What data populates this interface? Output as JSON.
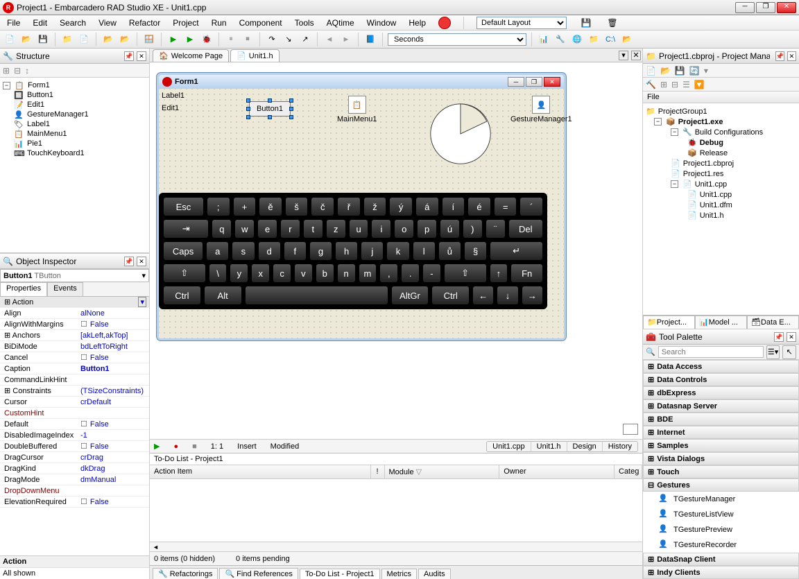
{
  "window": {
    "title": "Project1 - Embarcadero RAD Studio XE - Unit1.cpp"
  },
  "menu": {
    "items": [
      "File",
      "Edit",
      "Search",
      "View",
      "Refactor",
      "Project",
      "Run",
      "Component",
      "Tools",
      "AQtime",
      "Window",
      "Help"
    ],
    "layout_combo": "Default Layout"
  },
  "toolbar2_combo": "Seconds",
  "structure": {
    "title": "Structure",
    "root": "Form1",
    "children": [
      "Button1",
      "Edit1",
      "GestureManager1",
      "Label1",
      "MainMenu1",
      "Pie1",
      "TouchKeyboard1"
    ]
  },
  "object_inspector": {
    "title": "Object Inspector",
    "combo": "Button1  TButton",
    "tabs": [
      "Properties",
      "Events"
    ],
    "footer_label": "Action",
    "shown_label": "All shown",
    "props": [
      {
        "name": "Action",
        "val": "",
        "expand": true,
        "highlight": true
      },
      {
        "name": "Align",
        "val": "alNone"
      },
      {
        "name": "AlignWithMargins",
        "val": "False",
        "check": true
      },
      {
        "name": "Anchors",
        "val": "[akLeft,akTop]",
        "expand": true
      },
      {
        "name": "BiDiMode",
        "val": "bdLeftToRight"
      },
      {
        "name": "Cancel",
        "val": "False",
        "check": true
      },
      {
        "name": "Caption",
        "val": "Button1",
        "bold": true
      },
      {
        "name": "CommandLinkHint",
        "val": ""
      },
      {
        "name": "Constraints",
        "val": "(TSizeConstraints)",
        "expand": true
      },
      {
        "name": "Cursor",
        "val": "crDefault"
      },
      {
        "name": "CustomHint",
        "val": "",
        "red": true
      },
      {
        "name": "Default",
        "val": "False",
        "check": true
      },
      {
        "name": "DisabledImageIndex",
        "val": "-1"
      },
      {
        "name": "DoubleBuffered",
        "val": "False",
        "check": true
      },
      {
        "name": "DragCursor",
        "val": "crDrag"
      },
      {
        "name": "DragKind",
        "val": "dkDrag"
      },
      {
        "name": "DragMode",
        "val": "dmManual"
      },
      {
        "name": "DropDownMenu",
        "val": "",
        "red": true
      },
      {
        "name": "ElevationRequired",
        "val": "False",
        "check": true
      }
    ]
  },
  "editor_tabs": [
    "Welcome Page",
    "Unit1.h"
  ],
  "form_designer": {
    "title": "Form1",
    "label1": "Label1",
    "edit1": "Edit1",
    "button1": "Button1",
    "mainmenu": "MainMenu1",
    "gesture": "GestureManager1",
    "keyboard_rows": [
      [
        "Esc",
        ";",
        "+",
        "ě",
        "š",
        "č",
        "ř",
        "ž",
        "ý",
        "á",
        "í",
        "é",
        "=",
        "´"
      ],
      [
        "⇥",
        "q",
        "w",
        "e",
        "r",
        "t",
        "z",
        "u",
        "i",
        "o",
        "p",
        "ú",
        ")",
        "¨",
        "Del"
      ],
      [
        "Caps",
        "a",
        "s",
        "d",
        "f",
        "g",
        "h",
        "j",
        "k",
        "l",
        "ů",
        "§",
        "↵"
      ],
      [
        "⇧",
        "\\",
        "y",
        "x",
        "c",
        "v",
        "b",
        "n",
        "m",
        ",",
        ".",
        "-",
        "⇧",
        "↑",
        "Fn"
      ],
      [
        "Ctrl",
        "Alt",
        " ",
        "AltGr",
        "Ctrl",
        "←",
        "↓",
        "→"
      ]
    ]
  },
  "editor_status": {
    "pos": "1: 1",
    "mode": "Insert",
    "state": "Modified",
    "tabs": [
      "Unit1.cpp",
      "Unit1.h",
      "Design",
      "History"
    ]
  },
  "todo": {
    "title": "To-Do List - Project1",
    "cols": [
      "Action Item",
      "!",
      "Module",
      "Owner",
      "Categ"
    ],
    "status1": "0 items (0 hidden)",
    "status2": "0 items pending"
  },
  "bottom_tabs": [
    "Refactorings",
    "Find References",
    "To-Do List - Project1",
    "Metrics",
    "Audits"
  ],
  "project_mgr": {
    "title": "Project1.cbproj - Project Mana...",
    "file_label": "File",
    "group": "ProjectGroup1",
    "project": "Project1.exe",
    "build_cfg": "Build Configurations",
    "debug": "Debug",
    "release": "Release",
    "cbproj": "Project1.cbproj",
    "res": "Project1.res",
    "unit": "Unit1.cpp",
    "unit_cpp": "Unit1.cpp",
    "unit_dfm": "Unit1.dfm",
    "unit_h": "Unit1.h",
    "tabs": [
      "Project...",
      "Model ...",
      "Data E..."
    ]
  },
  "tool_palette": {
    "title": "Tool Palette",
    "search_placeholder": "Search",
    "categories": [
      "Data Access",
      "Data Controls",
      "dbExpress",
      "Datasnap Server",
      "BDE",
      "Internet",
      "Samples",
      "Vista Dialogs",
      "Touch"
    ],
    "gestures_cat": "Gestures",
    "gesture_items": [
      "TGestureManager",
      "TGestureListView",
      "TGesturePreview",
      "TGestureRecorder"
    ],
    "more_cats": [
      "DataSnap Client",
      "Indy Clients"
    ]
  }
}
